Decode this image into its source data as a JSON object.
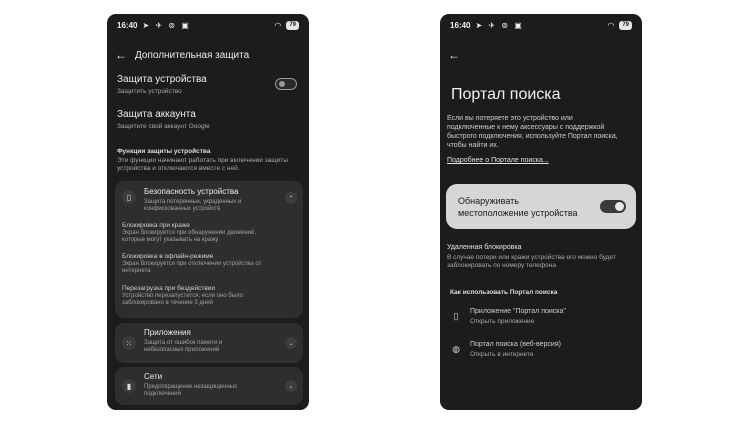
{
  "status_bar": {
    "time": "16:40",
    "battery": "79"
  },
  "left_screen": {
    "title": "Дополнительная защита",
    "device_protection": {
      "title": "Защита устройства",
      "subtitle": "Защитить устройство"
    },
    "account_protection": {
      "title": "Защита аккаунта",
      "subtitle": "Защитите свой аккаунт Google"
    },
    "features_section": {
      "title": "Функции защиты устройства",
      "description_line1": "Эти функции начинают работать при включении защиты",
      "description_line2": "устройства и отключаются вместе с ней."
    },
    "device_security_card": {
      "title": "Безопасность устройства",
      "subtitle_line1": "Защита потерянных, украденных и",
      "subtitle_line2": "конфискованных устройств",
      "items": [
        {
          "title": "Блокировка при краже",
          "desc_line1": "Экран блокируется при обнаружении движений,",
          "desc_line2": "которые могут указывать на кражу"
        },
        {
          "title": "Блокировка в офлайн-режиме",
          "desc_line1": "Экран блокируется при отключении устройства от",
          "desc_line2": "интернета"
        },
        {
          "title": "Перезагрузка при бездействии",
          "desc_line1": "Устройство перезапустится, если оно было",
          "desc_line2": "заблокировано в течение 3 дней"
        }
      ]
    },
    "apps_card": {
      "title": "Приложения",
      "subtitle_line1": "Защита от ошибок памяти и",
      "subtitle_line2": "небезопасных приложений"
    },
    "networks_card": {
      "title": "Сети",
      "subtitle_line1": "Предотвращение незащищенных",
      "subtitle_line2": "подключений"
    }
  },
  "right_screen": {
    "title": "Портал поиска",
    "description": [
      "Если вы потеряете это устройство или",
      "подключенные к нему аксессуары с поддержкой",
      "быстрого подключения, используйте Портал поиска,",
      "чтобы найти их."
    ],
    "more_link": "Подробнее о Портале поиска...",
    "location_toggle": {
      "line1": "Обнаруживать",
      "line2": "местоположение устройства",
      "state": "on"
    },
    "remote_lock": {
      "title": "Удаленная блокировка",
      "desc_line1": "В случае потери или кражи устройства его можно будет",
      "desc_line2": "заблокировать по номеру телефона"
    },
    "how_to_use": {
      "title": "Как использовать Портал поиска",
      "items": [
        {
          "title": "Приложение \"Портал поиска\"",
          "subtitle": "Открыть приложение",
          "icon": "phone-icon"
        },
        {
          "title": "Портал поиска (веб-версия)",
          "subtitle": "Открыть в интернете",
          "icon": "globe-icon"
        }
      ]
    }
  }
}
